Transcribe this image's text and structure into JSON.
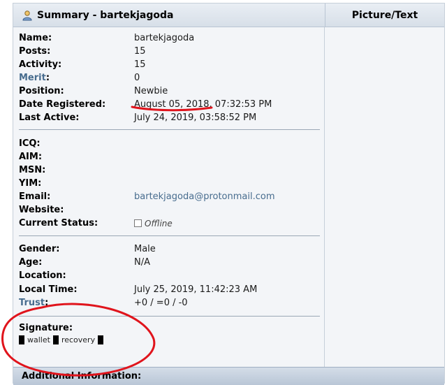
{
  "header": {
    "summary_title": "Summary - bartekjagoda",
    "picture_title": "Picture/Text"
  },
  "profile": {
    "group1": [
      {
        "label": "Name:",
        "value": "bartekjagoda",
        "label_link": false
      },
      {
        "label": "Posts:",
        "value": "15",
        "label_link": false
      },
      {
        "label": "Activity:",
        "value": "15",
        "label_link": false
      },
      {
        "label": "Merit",
        "suffix": ":",
        "value": "0",
        "label_link": true
      },
      {
        "label": "Position:",
        "value": "Newbie",
        "label_link": false
      },
      {
        "label": "Date Registered:",
        "value": "August 05, 2018, 07:32:53 PM",
        "label_link": false
      },
      {
        "label": "Last Active:",
        "value": "July 24, 2019, 03:58:52 PM",
        "label_link": false
      }
    ],
    "group2": [
      {
        "label": "ICQ:",
        "value": ""
      },
      {
        "label": "AIM:",
        "value": ""
      },
      {
        "label": "MSN:",
        "value": ""
      },
      {
        "label": "YIM:",
        "value": ""
      },
      {
        "label": "Email:",
        "value": "bartekjagoda@protonmail.com"
      },
      {
        "label": "Website:",
        "value": ""
      },
      {
        "label": "Current Status:",
        "value": "Offline"
      }
    ],
    "group3": [
      {
        "label": "Gender:",
        "value": "Male"
      },
      {
        "label": "Age:",
        "value": "N/A"
      },
      {
        "label": "Location:",
        "value": ""
      },
      {
        "label": "Local Time:",
        "value": "July 25, 2019, 11:42:23 AM"
      },
      {
        "label": "Trust",
        "suffix": ":",
        "value": "+0 / =0 / -0"
      }
    ],
    "signature": {
      "label": "Signature:",
      "words": [
        "wallet",
        "recovery"
      ]
    }
  },
  "footer": {
    "additional_info": "Additional Information:"
  },
  "colors": {
    "link": "#476c8e",
    "annotation_red": "#e0141c"
  }
}
